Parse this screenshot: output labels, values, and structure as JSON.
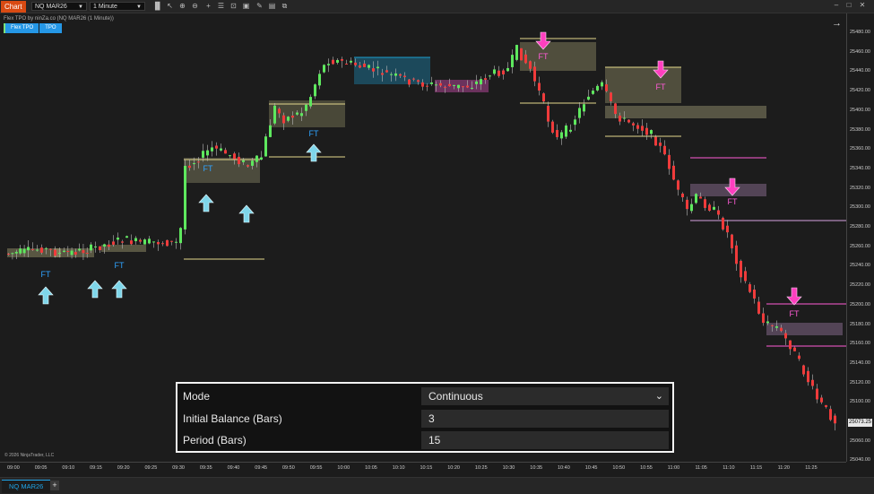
{
  "toolbar": {
    "chart_label": "Chart",
    "instrument": "NQ MAR26",
    "interval": "1 Minute"
  },
  "indicator": {
    "title": "Flex TPO by ninZa.co (NQ MAR26 (1 Minute))",
    "buttons": [
      "Flex TPO",
      "TPO"
    ]
  },
  "copyright": "© 2026 NinjaTrader, LLC",
  "price_axis": [
    "25480.00",
    "25460.00",
    "25440.00",
    "25420.00",
    "25400.00",
    "25380.00",
    "25360.00",
    "25340.00",
    "25320.00",
    "25300.00",
    "25280.00",
    "25260.00",
    "25240.00",
    "25220.00",
    "25200.00",
    "25180.00",
    "25160.00",
    "25140.00",
    "25120.00",
    "25100.00",
    "25080.00",
    "25060.00",
    "25040.00"
  ],
  "last_price": "25073.25",
  "time_axis": [
    "09:00",
    "09:05",
    "09:10",
    "09:15",
    "09:20",
    "09:25",
    "09:30",
    "09:35",
    "09:40",
    "09:45",
    "09:50",
    "09:55",
    "10:00",
    "10:05",
    "10:10",
    "10:15",
    "10:20",
    "10:25",
    "10:30",
    "10:35",
    "10:40",
    "10:45",
    "10:50",
    "10:55",
    "11:00",
    "11:05",
    "11:10",
    "11:15",
    "11:20",
    "11:25"
  ],
  "signal_text": "FT",
  "params": {
    "rows": [
      {
        "label": "Mode",
        "value": "Continuous"
      },
      {
        "label": "Initial Balance (Bars)",
        "value": "3"
      },
      {
        "label": "Period (Bars)",
        "value": "15"
      }
    ]
  },
  "tabs": {
    "active": "NQ MAR26",
    "add": "+"
  },
  "colors": {
    "up": "#5ee85e",
    "down": "#ef3b3b",
    "buy": "#7fd6ea",
    "sell": "#ff3fbf"
  }
}
